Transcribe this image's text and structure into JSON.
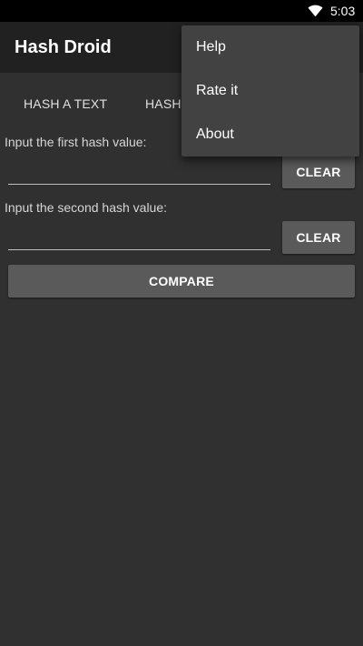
{
  "status_bar": {
    "time": "5:03",
    "wifi_icon": "wifi-icon"
  },
  "app_bar": {
    "title": "Hash Droid"
  },
  "tabs": [
    {
      "label": "HASH A TEXT"
    },
    {
      "label": "HASH"
    }
  ],
  "compare": {
    "first_label": "Input the first hash value:",
    "first_value": "",
    "second_label": "Input the second hash value:",
    "second_value": "",
    "clear_label": "CLEAR",
    "compare_label": "COMPARE"
  },
  "overflow_menu": {
    "items": [
      {
        "label": "Help"
      },
      {
        "label": "Rate it"
      },
      {
        "label": "About"
      }
    ]
  },
  "colors": {
    "background": "#303030",
    "app_bar": "#212121",
    "button": "#5a5a5a",
    "menu": "#424242"
  }
}
